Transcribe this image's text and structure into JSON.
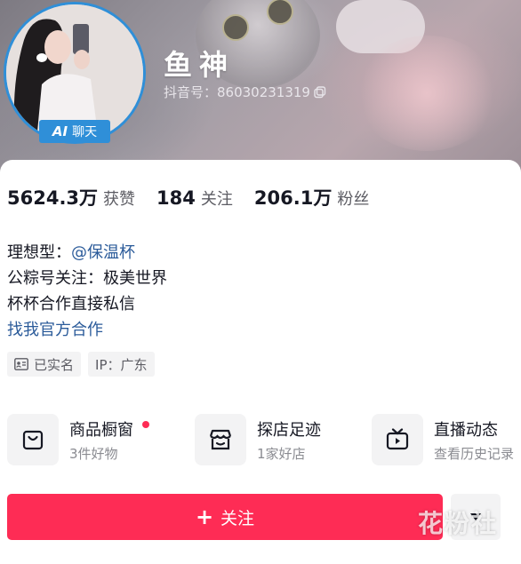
{
  "profile": {
    "nickname": "鱼神",
    "douyin_id": "抖音号：86030231319",
    "ai_badge": {
      "ai": "AI",
      "label": "聊天"
    }
  },
  "stats": [
    {
      "value": "5624.3万",
      "label": "获赞"
    },
    {
      "value": "184",
      "label": "关注"
    },
    {
      "value": "206.1万",
      "label": "粉丝"
    }
  ],
  "bio": {
    "line1_prefix": "理想型：",
    "line1_mention": "@保温杯",
    "line2": "公粽号关注：极美世界",
    "line3": "杯杯合作直接私信",
    "link": "找我官方合作"
  },
  "tags": [
    {
      "icon": "id-card-icon",
      "label": "已实名"
    },
    {
      "label": "IP：广东"
    }
  ],
  "features": [
    {
      "icon": "shopping-bag-icon",
      "title": "商品橱窗",
      "subtitle": "3件好物",
      "has_dot": true
    },
    {
      "icon": "store-icon",
      "title": "探店足迹",
      "subtitle": "1家好店"
    },
    {
      "icon": "tv-icon",
      "title": "直播动态",
      "subtitle": "查看历史记录"
    }
  ],
  "actions": {
    "follow_label": "关注",
    "more_icon": "caret-down-icon"
  },
  "watermark": "花粉社",
  "colors": {
    "accent": "#fe2c55",
    "badge_blue": "#2f8fd8",
    "link_blue": "#2b5b9a"
  }
}
